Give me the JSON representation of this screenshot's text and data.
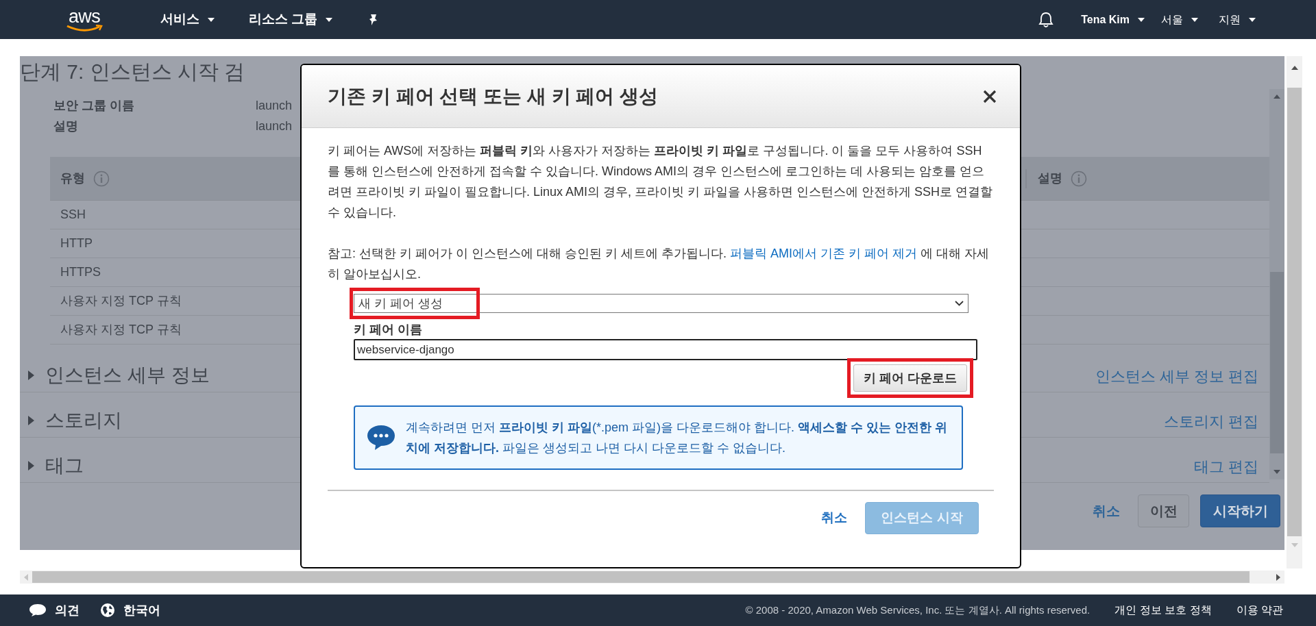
{
  "top_nav": {
    "logo_text": "aws",
    "menus": [
      {
        "label": "서비스"
      },
      {
        "label": "리소스 그룹"
      }
    ],
    "user": "Tena Kim",
    "region": "서울",
    "support": "지원"
  },
  "page": {
    "title": "단계 7: 인스턴스 시작 검",
    "fields": [
      {
        "label": "보안 그룹 이름",
        "value": "launch"
      },
      {
        "label": "설명",
        "value": "launch"
      }
    ],
    "table": {
      "columns": [
        "유형",
        "설명"
      ],
      "rows": [
        "SSH",
        "HTTP",
        "HTTPS",
        "사용자 지정 TCP 규칙",
        "사용자 지정 TCP 규칙"
      ]
    },
    "sections": [
      {
        "title": "인스턴스 세부 정보",
        "edit_link": "인스턴스 세부 정보 편집",
        "expanded": false
      },
      {
        "title": "스토리지",
        "edit_link": "스토리지 편집",
        "expanded": false
      },
      {
        "title": "태그",
        "edit_link": "태그 편집",
        "expanded": false
      }
    ],
    "buttons": {
      "cancel": "취소",
      "previous": "이전",
      "launch": "시작하기"
    }
  },
  "dialog": {
    "title": "기존 키 페어 선택 또는 새 키 페어 생성",
    "intro": [
      {
        "text": "키 페어는 AWS에 저장하는 ",
        "bold": false
      },
      {
        "text": "퍼블릭 키",
        "bold": true
      },
      {
        "text": "와 사용자가 저장하는 ",
        "bold": false
      },
      {
        "text": "프라이빗 키 파일",
        "bold": true
      },
      {
        "text": "로 구성됩니다. 이 둘을 모두 사용하여 SSH를 통해 인스턴스에 안전하게 접속할 수 있습니다. Windows AMI의 경우 인스턴스에 로그인하는 데 사용되는 암호를 얻으려면 프라이빗 키 파일이 필요합니다. Linux AMI의 경우, 프라이빗 키 파일을 사용하면 인스턴스에 안전하게 SSH로 연결할 수 있습니다.",
        "bold": false
      }
    ],
    "note": {
      "before": "참고: 선택한 키 페어가 이 인스턴스에 대해 승인된 키 세트에 추가됩니다. ",
      "link": "퍼블릭 AMI에서 기존 키 페어 제거",
      "after": " 에 대해 자세히 알아보십시오."
    },
    "select_value": "새 키 페어 생성",
    "key_name_label": "키 페어 이름",
    "key_name_value": "webservice-django",
    "download_button": "키 페어 다운로드",
    "info": [
      {
        "text": "계속하려면 먼저 ",
        "bold": false
      },
      {
        "text": "프라이빗 키 파일",
        "bold": true
      },
      {
        "text": "(*.pem 파일)을 다운로드해야 합니다. ",
        "bold": false
      },
      {
        "text": "액세스할 수 있는 안전한 위치에 저장합니다.",
        "bold": true
      },
      {
        "text": " 파일은 생성되고 나면 다시 다운로드할 수 없습니다.",
        "bold": false
      }
    ],
    "cancel": "취소",
    "launch_button": {
      "label": "인스턴스 시작",
      "disabled": true
    }
  },
  "footer": {
    "feedback": "의견",
    "language": "한국어",
    "copyright": "© 2008 - 2020, Amazon Web Services, Inc. 또는 계열사. All rights reserved.",
    "privacy": "개인 정보 보호 정책",
    "terms": "이용 약관"
  }
}
